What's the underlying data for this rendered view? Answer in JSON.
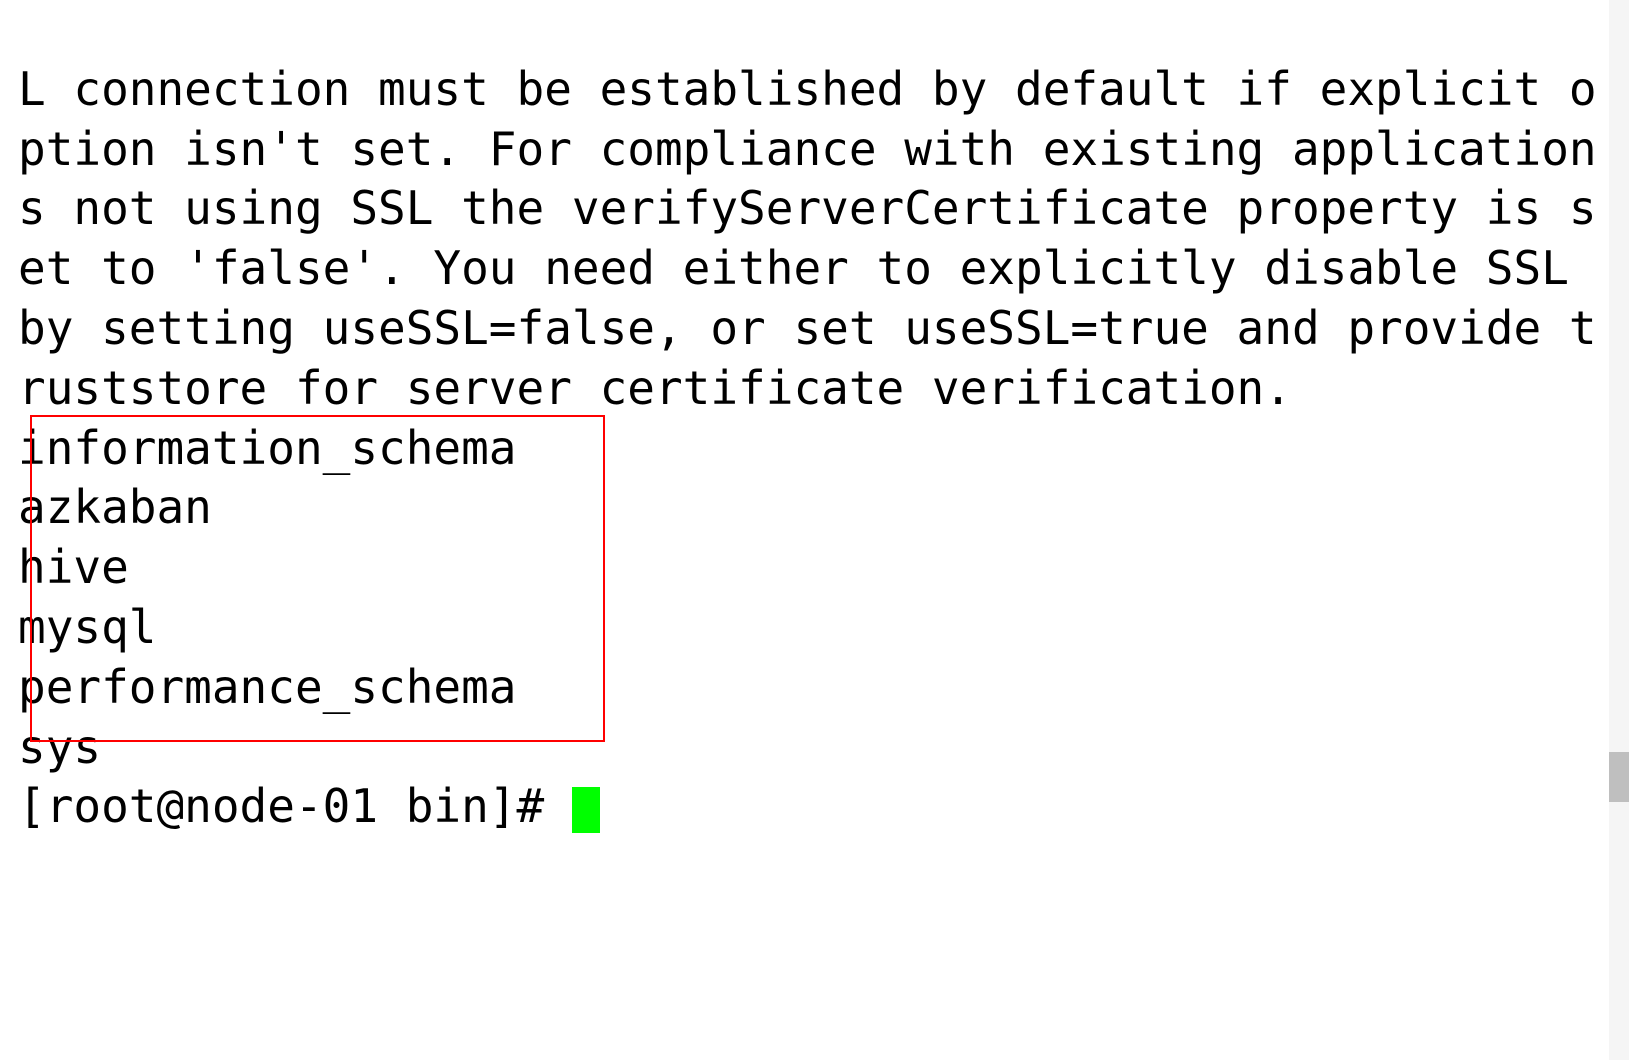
{
  "ssl_warning": "L connection must be established by default if explicit option isn't set. For compliance with existing applications not using SSL the verifyServerCertificate property is set to 'false'. You need either to explicitly disable SSL by setting useSSL=false, or set useSSL=true and provide truststore for server certificate verification.",
  "databases": [
    "information_schema",
    "azkaban",
    "hive",
    "mysql",
    "performance_schema",
    "sys"
  ],
  "prompt": "[root@node-01 bin]# "
}
